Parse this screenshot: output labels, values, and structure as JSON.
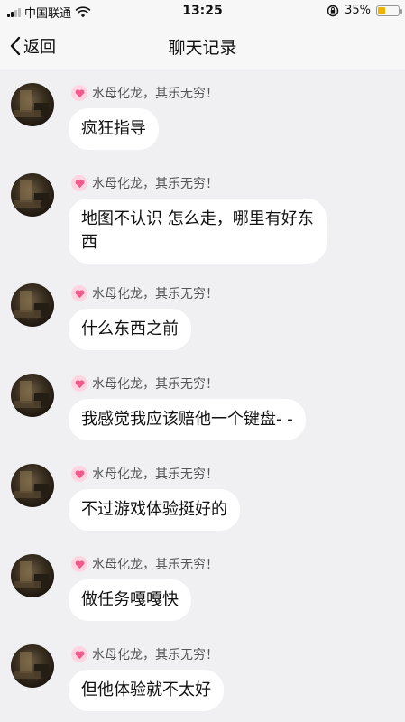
{
  "status": {
    "carrier": "中国联通",
    "time": "13:25",
    "battery_pct": "35%",
    "battery_level": 0.35
  },
  "nav": {
    "back_label": "返回",
    "title": "聊天记录"
  },
  "messages": [
    {
      "sender": "水母化龙，其乐无穷！",
      "text": "疯狂指导"
    },
    {
      "sender": "水母化龙，其乐无穷！",
      "text": "地图不认识 怎么走，哪里有好东西"
    },
    {
      "sender": "水母化龙，其乐无穷！",
      "text": "什么东西之前"
    },
    {
      "sender": "水母化龙，其乐无穷！",
      "text": "我感觉我应该赔他一个键盘- -"
    },
    {
      "sender": "水母化龙，其乐无穷！",
      "text": "不过游戏体验挺好的"
    },
    {
      "sender": "水母化龙，其乐无穷！",
      "text": "做任务嘎嘎快"
    },
    {
      "sender": "水母化龙，其乐无穷！",
      "text": "但他体验就不太好"
    }
  ],
  "colors": {
    "background": "#f0f0f2",
    "bubble": "#ffffff",
    "heart_badge": "#ffd5e2",
    "heart": "#f05a8c",
    "battery_fill": "#f0b400"
  }
}
